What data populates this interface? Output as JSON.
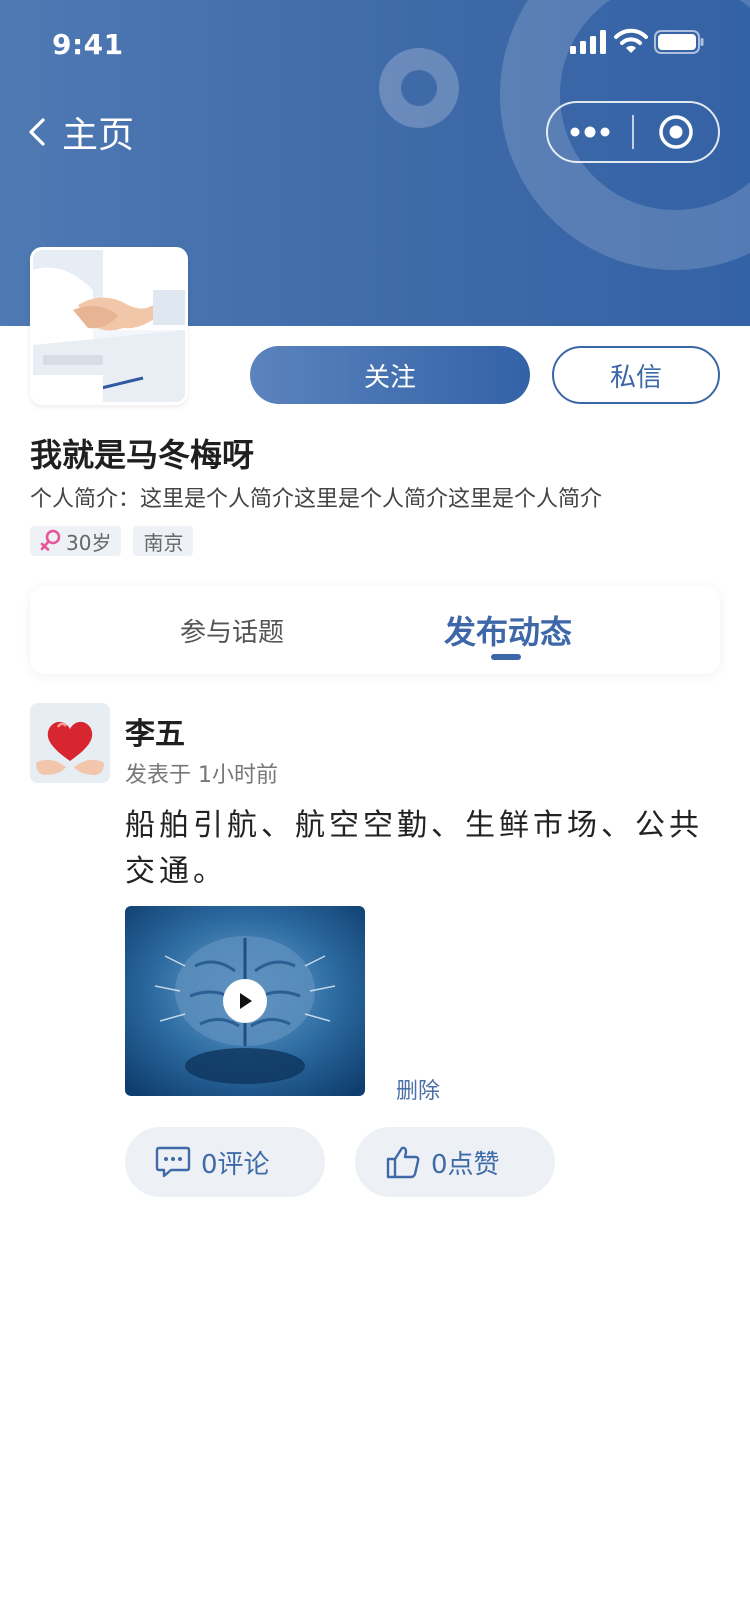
{
  "status_bar": {
    "time": "9:41"
  },
  "nav": {
    "back_label": "主页"
  },
  "profile": {
    "name": "我就是马冬梅呀",
    "bio": "个人简介：这里是个人简介这里是个人简介这里是个人简介",
    "age_tag": "30岁",
    "city_tag": "南京"
  },
  "actions": {
    "follow_label": "关注",
    "message_label": "私信"
  },
  "tabs": [
    {
      "label": "参与话题",
      "active": false
    },
    {
      "label": "发布动态",
      "active": true
    }
  ],
  "post": {
    "author": "李五",
    "time": "发表于 1小时前",
    "content": "船舶引航、航空空勤、生鲜市场、公共交通。",
    "delete_label": "删除",
    "comment_label": "0评论",
    "like_label": "0点赞"
  },
  "colors": {
    "brand": "#3d67a9",
    "header_bg": "#4574b0",
    "female_icon": "#e8559a"
  }
}
